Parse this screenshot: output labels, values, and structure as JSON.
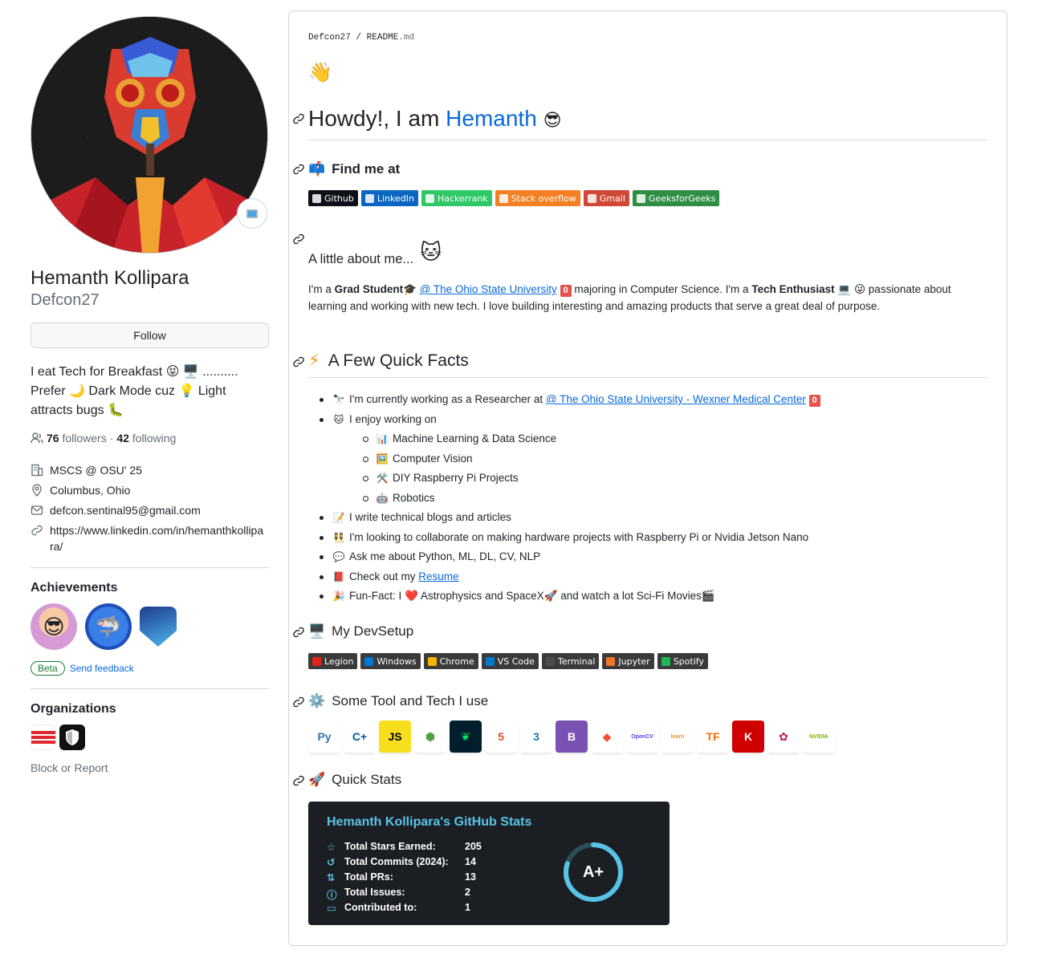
{
  "profile": {
    "full_name": "Hemanth Kollipara",
    "username": "Defcon27",
    "follow_label": "Follow",
    "bio_line1": "I eat Tech for Breakfast",
    "bio_line1_tail": "..........",
    "bio_line2_a": "Prefer",
    "bio_line2_b": "Dark Mode cuz",
    "bio_line2_c": "Light",
    "bio_line3": "attracts bugs",
    "followers_count": "76",
    "followers_label": "followers",
    "dot": "·",
    "following_count": "42",
    "following_label": "following",
    "work": "MSCS @ OSU' 25",
    "location": "Columbus, Ohio",
    "email": "defcon.sentinal95@gmail.com",
    "website": "https://www.linkedin.com/in/hemanthkollipara/",
    "achievements_title": "Achievements",
    "beta_label": "Beta",
    "send_feedback": "Send feedback",
    "organizations_title": "Organizations",
    "block_report": "Block or Report"
  },
  "readme": {
    "crumb_user": "Defcon27",
    "crumb_sep": "/",
    "crumb_file": "README",
    "crumb_ext": ".md",
    "title_prefix": "Howdy!, I am",
    "title_name": "Hemanth",
    "find_me_title": "Find me at",
    "find_me_links": [
      {
        "label": "Github",
        "color": "#0d1117",
        "icon": "github-icon"
      },
      {
        "label": "LinkedIn",
        "color": "#0a66c2",
        "icon": "linkedin-icon"
      },
      {
        "label": "Hackerrank",
        "color": "#2ec866",
        "icon": "hackerrank-icon"
      },
      {
        "label": "Stack overflow",
        "color": "#f48024",
        "icon": "stackoverflow-icon"
      },
      {
        "label": "Gmail",
        "color": "#d14836",
        "icon": "gmail-icon"
      },
      {
        "label": "GeeksforGeeks",
        "color": "#2f8d46",
        "icon": "geeksforgeeks-icon"
      }
    ],
    "about_title": "A little about me...",
    "about": {
      "p1": "I'm a",
      "grad": "Grad Student",
      "osu": "@ The Ohio State University",
      "zero": "0",
      "p2": "majoring in Computer Science. I'm a",
      "tech": "Tech Enthusiast",
      "p3": "passionate about",
      "p4": "learning and working with new tech. I love building interesting and amazing products that serve a great deal of purpose."
    },
    "facts_title": "A Few Quick Facts",
    "facts": {
      "f1": "I'm currently working as a Researcher at",
      "f1_link": "@ The Ohio State University - Wexner Medical Center",
      "f1_zero": "0",
      "f2": "I enjoy working on",
      "sub": [
        "Machine Learning & Data Science",
        "Computer Vision",
        "DIY Raspberry Pi Projects",
        "Robotics"
      ],
      "f3": "I write technical blogs and articles",
      "f4": "I'm looking to collaborate on making hardware projects with Raspberry Pi or Nvidia Jetson Nano",
      "f5": "Ask me about Python, ML, DL, CV, NLP",
      "f6": "Check out my",
      "f6_link": "Resume",
      "f7a": "Fun-Fact: I",
      "f7b": "Astrophysics and SpaceX",
      "f7c": "and watch a lot Sci-Fi Movies"
    },
    "devsetup_title": "My DevSetup",
    "devsetup": [
      {
        "label": "Legion",
        "icon": "lenovo-icon"
      },
      {
        "label": "Windows",
        "icon": "windows-icon"
      },
      {
        "label": "Chrome",
        "icon": "chrome-icon"
      },
      {
        "label": "VS Code",
        "icon": "vscode-icon"
      },
      {
        "label": "Terminal",
        "icon": "terminal-icon"
      },
      {
        "label": "Jupyter",
        "icon": "jupyter-icon"
      },
      {
        "label": "Spotify",
        "icon": "spotify-icon"
      }
    ],
    "tools_title": "Some Tool and Tech I use",
    "tools": [
      {
        "name": "python-icon",
        "glyph": "Py",
        "bg": "#ffffff",
        "fg": "#3776ab"
      },
      {
        "name": "cplusplus-icon",
        "glyph": "C+",
        "bg": "#ffffff",
        "fg": "#00599c"
      },
      {
        "name": "javascript-icon",
        "glyph": "JS",
        "bg": "#f7df1e",
        "fg": "#000000"
      },
      {
        "name": "nodejs-icon",
        "glyph": "⬢",
        "bg": "#ffffff",
        "fg": "#539e43"
      },
      {
        "name": "mongodb-icon",
        "glyph": "❦",
        "bg": "#001e2b",
        "fg": "#00ed64"
      },
      {
        "name": "html5-icon",
        "glyph": "5",
        "bg": "#ffffff",
        "fg": "#e34f26"
      },
      {
        "name": "css3-icon",
        "glyph": "3",
        "bg": "#ffffff",
        "fg": "#1572b6"
      },
      {
        "name": "bootstrap-icon",
        "glyph": "B",
        "bg": "#7952b3",
        "fg": "#ffffff"
      },
      {
        "name": "git-icon",
        "glyph": "◆",
        "bg": "#ffffff",
        "fg": "#f05032"
      },
      {
        "name": "opencv-icon",
        "glyph": "OpenCV",
        "bg": "#ffffff",
        "fg": "#5c3ee8"
      },
      {
        "name": "scikit-learn-icon",
        "glyph": "learn",
        "bg": "#ffffff",
        "fg": "#f7931e"
      },
      {
        "name": "tensorflow-icon",
        "glyph": "TF",
        "bg": "#ffffff",
        "fg": "#ff6f00"
      },
      {
        "name": "keras-icon",
        "glyph": "K",
        "bg": "#d00000",
        "fg": "#ffffff"
      },
      {
        "name": "raspberry-pi-icon",
        "glyph": "✿",
        "bg": "#ffffff",
        "fg": "#c51a4a"
      },
      {
        "name": "nvidia-icon",
        "glyph": "NVIDIA",
        "bg": "#ffffff",
        "fg": "#76b900"
      }
    ],
    "stats_title": "Quick Stats",
    "stats": {
      "card_title": "Hemanth Kollipara's GitHub Stats",
      "rows": [
        {
          "label": "Total Stars Earned:",
          "value": "205",
          "icon": "star-icon"
        },
        {
          "label": "Total Commits (2024):",
          "value": "14",
          "icon": "history-icon"
        },
        {
          "label": "Total PRs:",
          "value": "13",
          "icon": "pull-request-icon"
        },
        {
          "label": "Total Issues:",
          "value": "2",
          "icon": "issue-icon"
        },
        {
          "label": "Contributed to:",
          "value": "1",
          "icon": "repo-icon"
        }
      ],
      "grade": "A+",
      "grade_progress": 0.8
    }
  }
}
